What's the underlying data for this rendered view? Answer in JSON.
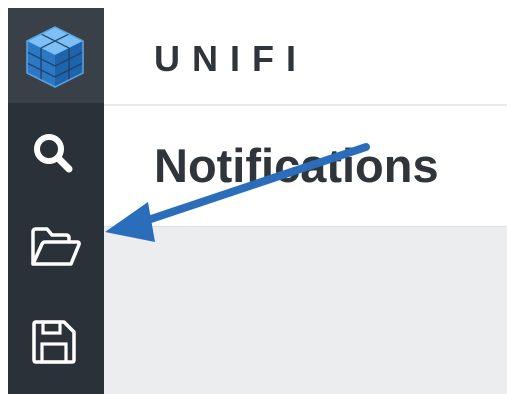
{
  "header": {
    "brand": "UNIFI"
  },
  "page": {
    "title": "Notifications"
  },
  "sidebar": {
    "items": [
      {
        "icon": "search-icon"
      },
      {
        "icon": "folder-open-icon"
      },
      {
        "icon": "save-icon"
      }
    ]
  },
  "annotation": {
    "arrow_color": "#2a6ebb"
  },
  "colors": {
    "sidebar_bg": "#2b3138",
    "logo_bg": "#3a4047",
    "logo_blue": "#3a8bd8",
    "content_bg": "#ebedef",
    "text": "#2f353b"
  }
}
